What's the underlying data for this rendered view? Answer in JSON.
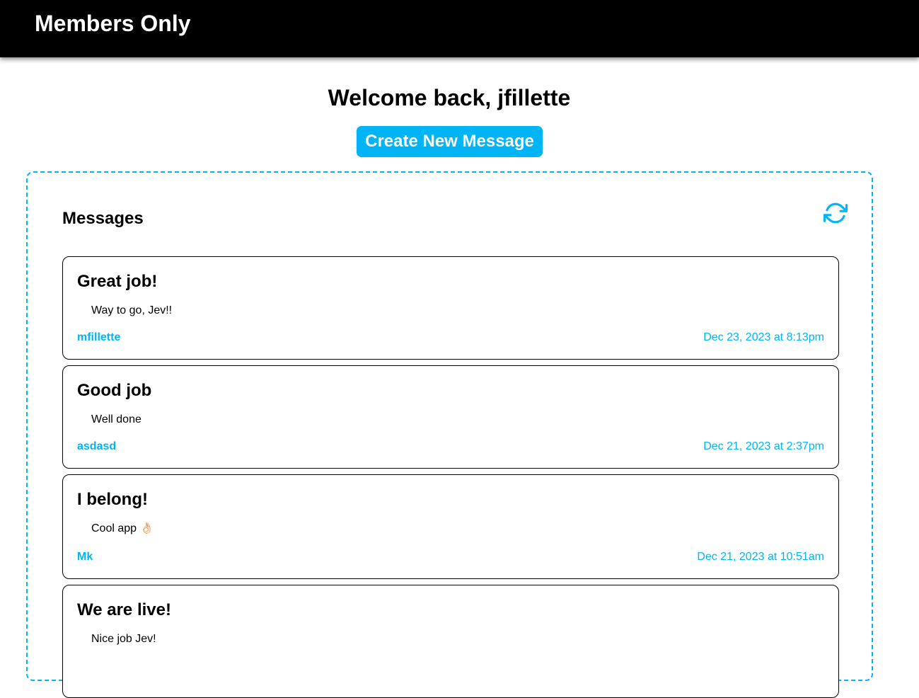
{
  "header": {
    "brand": "Members Only"
  },
  "main": {
    "welcome": "Welcome back, jfillette",
    "create_button": "Create New Message"
  },
  "messages_panel": {
    "title": "Messages",
    "refresh_icon": "refresh-icon",
    "accent_color": "#00b4f5",
    "items": [
      {
        "title": "Great job!",
        "body": "Way to go, Jev!!",
        "author": "mfillette",
        "date": "Dec 23, 2023 at 8:13pm"
      },
      {
        "title": "Good job",
        "body": "Well done",
        "author": "asdasd",
        "date": "Dec 21, 2023 at 2:37pm"
      },
      {
        "title": "I belong!",
        "body": "Cool app 👌🏻",
        "author": "Mk",
        "date": "Dec 21, 2023 at 10:51am"
      },
      {
        "title": "We are live!",
        "body": "Nice job Jev!",
        "author": "",
        "date": ""
      }
    ]
  }
}
